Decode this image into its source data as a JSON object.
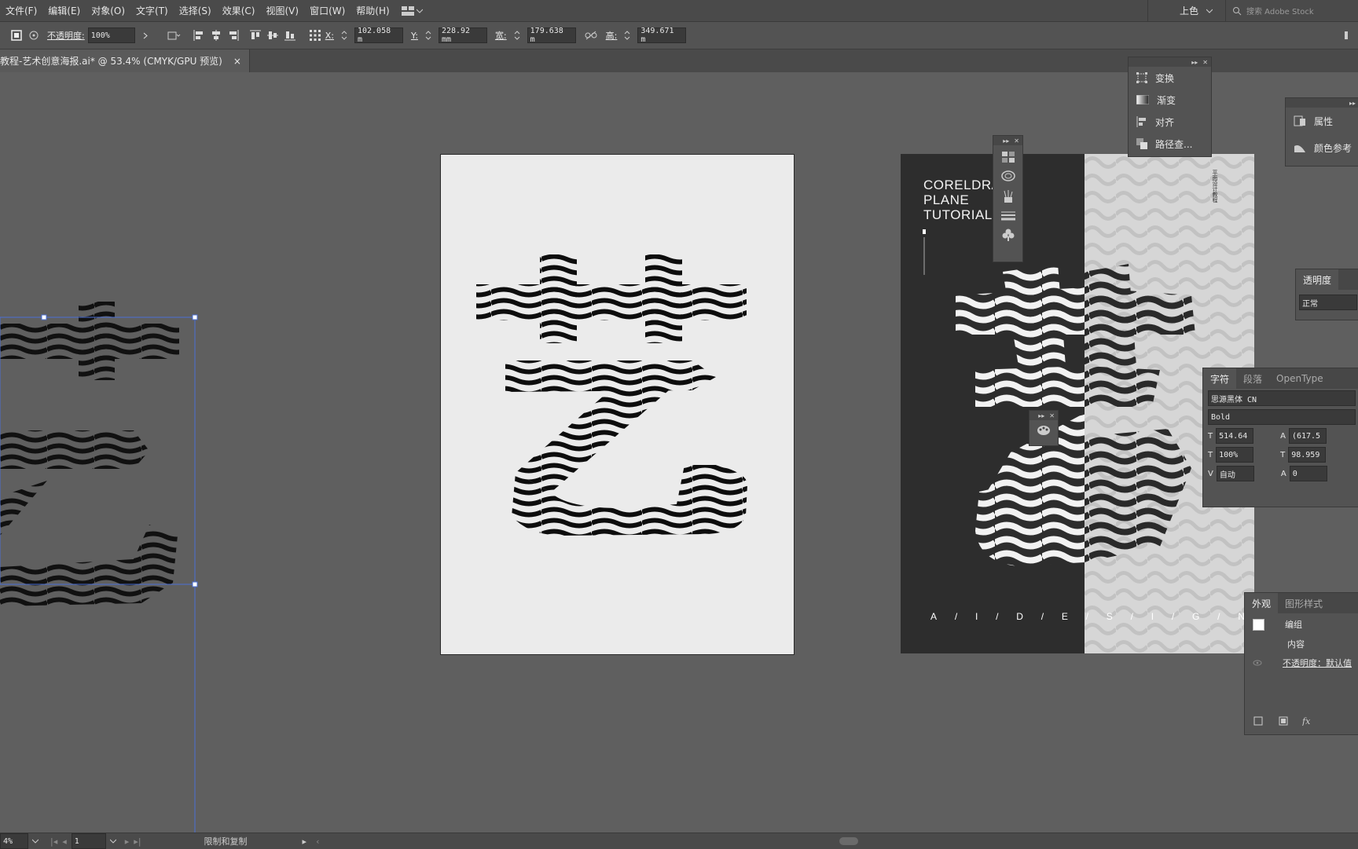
{
  "menubar": {
    "items": [
      "文件(F)",
      "编辑(E)",
      "对象(O)",
      "文字(T)",
      "选择(S)",
      "效果(C)",
      "视图(V)",
      "窗口(W)",
      "帮助(H)"
    ],
    "preset": "上色",
    "search_placeholder": "搜索 Adobe Stock"
  },
  "control": {
    "opacity_label": "不透明度:",
    "opacity_value": "100%",
    "x_label": "X:",
    "x_value": "102.058 m",
    "y_label": "Y:",
    "y_value": "228.92 mm",
    "w_label": "宽:",
    "w_value": "179.638 m",
    "h_label": "高:",
    "h_value": "349.671 m"
  },
  "document": {
    "tab_title": "教程-艺术创意海报.ai* @ 53.4% (CMYK/GPU 预览)",
    "close": "×"
  },
  "poster": {
    "title": "CORELDRA\nPLANE\nTUTORIAL",
    "letters": [
      "A",
      "/",
      "I",
      "/",
      "D",
      "/",
      "E",
      "/",
      "S",
      "/",
      "I",
      "/",
      "G",
      "/",
      "N"
    ],
    "vertical_text": "平面设计教程"
  },
  "panels": {
    "transform_group": {
      "items": [
        "变换",
        "渐变",
        "对齐",
        "路径查..."
      ]
    },
    "properties": {
      "items": [
        "属性",
        "颜色参考"
      ]
    },
    "transparency": {
      "title": "透明度",
      "mode": "正常"
    },
    "character": {
      "tabs": [
        "字符",
        "段落",
        "OpenType"
      ],
      "font": "思源黑体 CN",
      "style": "Bold",
      "size": "514.64",
      "leading": "(617.5",
      "vscale": "100%",
      "hscale": "98.959",
      "kerning": "自动",
      "tracking": "0"
    },
    "appearance": {
      "tabs": [
        "外观",
        "图形样式"
      ],
      "group": "编组",
      "content": "内容",
      "opacity": "不透明度：默认值"
    }
  },
  "status": {
    "zoom": "4%",
    "artboard": "1",
    "tool": "限制和复制"
  },
  "colors": {
    "accent": "#4b6fd6",
    "ui_dark": "#4a4a4a",
    "canvas": "#5f5f5f"
  }
}
